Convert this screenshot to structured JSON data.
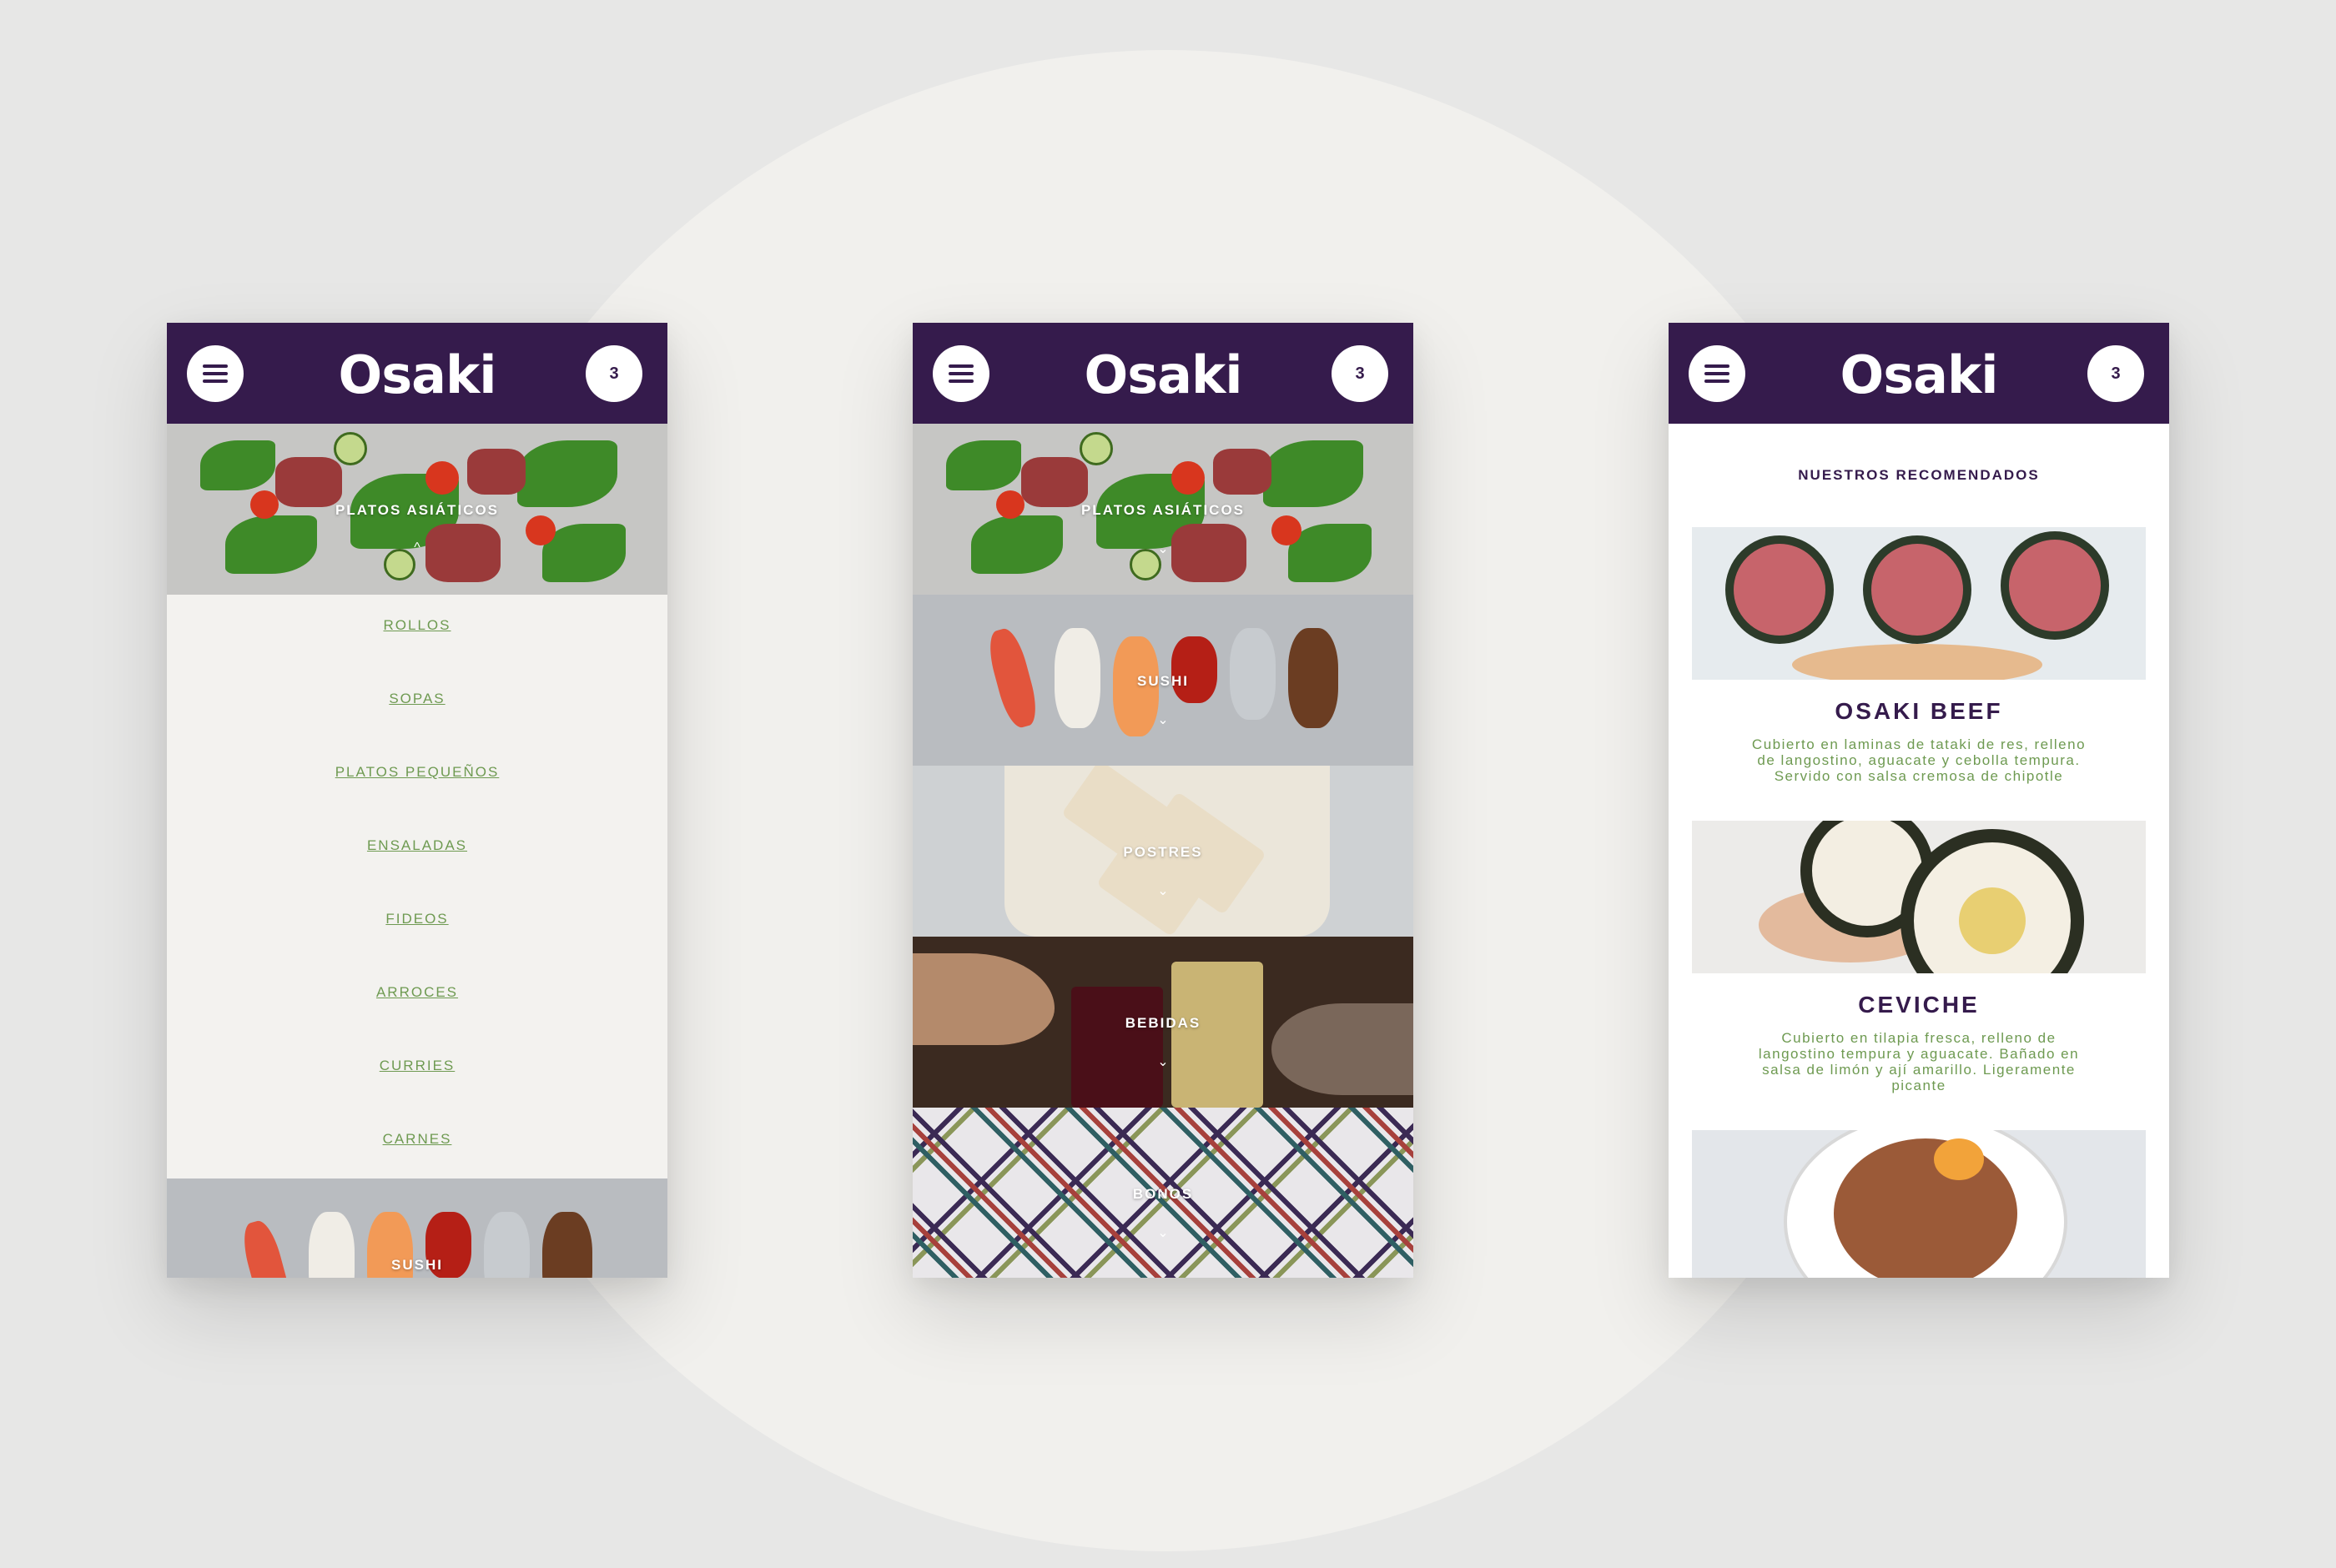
{
  "app": {
    "logo": "Osaki",
    "cart_count": "3"
  },
  "phone1": {
    "top_category": "PLATOS ASIÁTICOS",
    "top_chevron": "^",
    "submenu": [
      "ROLLOS",
      "SOPAS",
      "PLATOS PEQUEÑOS",
      "ENSALADAS",
      "FIDEOS",
      "ARROCES",
      "CURRIES",
      "CARNES"
    ],
    "bottom_category": "SUSHI"
  },
  "phone2": {
    "categories": [
      "PLATOS ASIÁTICOS",
      "SUSHI",
      "POSTRES",
      "BEBIDAS",
      "BONOS"
    ],
    "chevron": "⌄"
  },
  "phone3": {
    "section_title": "NUESTROS RECOMENDADOS",
    "items": [
      {
        "name": "OSAKI BEEF",
        "description": "Cubierto en laminas de tataki de res, relleno de langostino, aguacate y cebolla tempura. Servido con salsa cremosa de chipotle"
      },
      {
        "name": "CEVICHE",
        "description": "Cubierto en tilapia fresca, relleno de langostino tempura y aguacate. Bañado en salsa de limón y ají amarillo. Ligeramente picante"
      }
    ]
  },
  "colors": {
    "brand_purple": "#351b4c",
    "accent_green": "#6e9a51",
    "background": "#e7e7e6"
  },
  "icons": {
    "menu": "hamburger-menu-icon",
    "cart": "cart-count-badge",
    "chevron": "chevron-down-icon"
  }
}
